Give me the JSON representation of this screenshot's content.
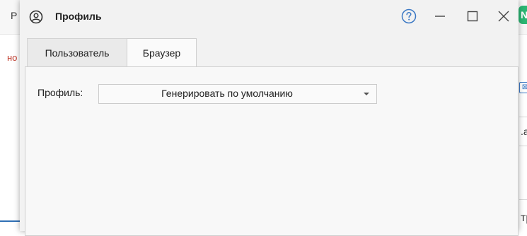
{
  "background": {
    "left_top_text": "Р",
    "left_red_text": "но",
    "right_badge": "N",
    "right_icon_glyph": "⊠",
    "right_field_text": ".a",
    "right_bottom_text": "тр"
  },
  "dialog": {
    "title": "Профиль",
    "tabs": [
      {
        "label": "Пользователь",
        "active": false
      },
      {
        "label": "Браузер",
        "active": true
      }
    ],
    "profile_label": "Профиль:",
    "profile_select": {
      "value": "Генерировать по умолчанию"
    },
    "colors": {
      "help_icon": "#3b78c4",
      "window_bg": "#f2f2f2",
      "panel_bg": "#f8f8f8"
    },
    "icons": [
      "user-circle-icon",
      "help-icon",
      "minimize-icon",
      "maximize-icon",
      "close-icon",
      "dropdown-arrow-icon"
    ]
  }
}
